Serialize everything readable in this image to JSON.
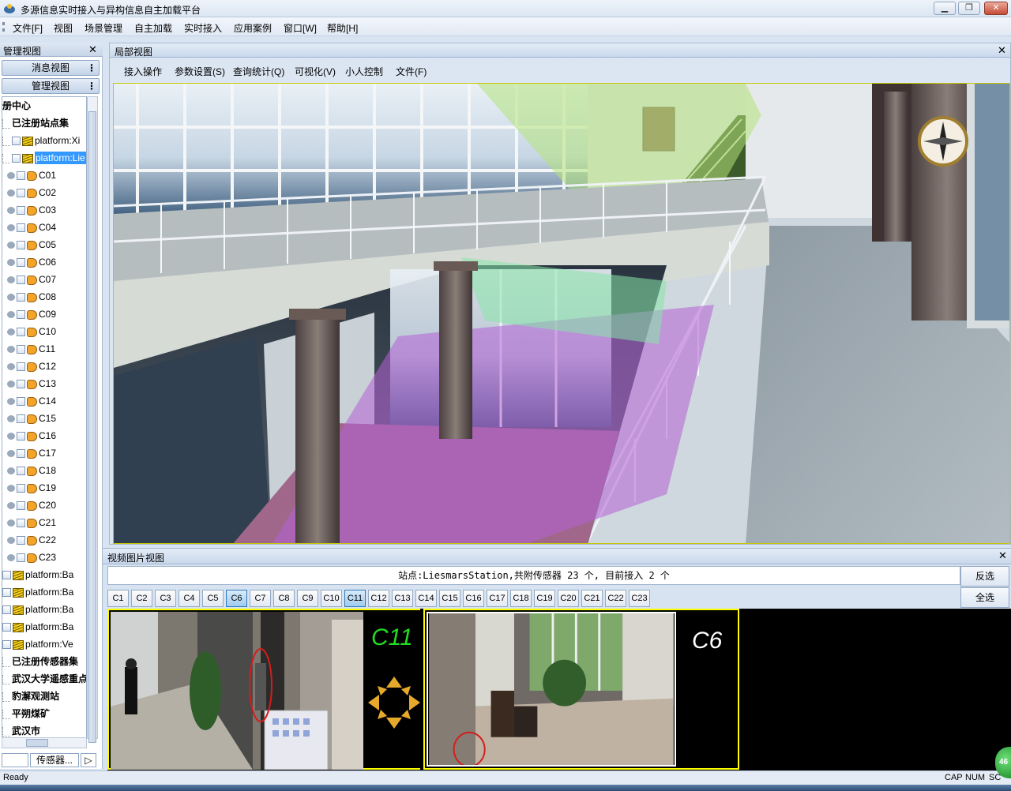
{
  "window": {
    "title": "多源信息实时接入与异构信息自主加载平台"
  },
  "menubar": [
    "文件[F]",
    "视图",
    "场景管理",
    "自主加载",
    "实时接入",
    "应用案例",
    "窗口[W]",
    "帮助[H]"
  ],
  "left_panel": {
    "title": "管理视图",
    "tabs": [
      "消息视图",
      "管理视图"
    ],
    "tree": {
      "root": "册中心",
      "registered_sites": "已注册站点集",
      "platform_1": "platform:Xi",
      "platform_selected": "platform:Lie",
      "cameras": [
        "C01",
        "C02",
        "C03",
        "C04",
        "C05",
        "C06",
        "C07",
        "C08",
        "C09",
        "C10",
        "C11",
        "C12",
        "C13",
        "C14",
        "C15",
        "C16",
        "C17",
        "C18",
        "C19",
        "C20",
        "C21",
        "C22",
        "C23"
      ],
      "platforms_more": [
        "platform:Ba",
        "platform:Ba",
        "platform:Ba",
        "platform:Ba",
        "platform:Ve"
      ],
      "groups": [
        "已注册传感器集",
        "武汉大学遥感重点",
        "豹澥观测站",
        "平朔煤矿",
        "武汉市"
      ]
    },
    "bottom_tab": "传感器..."
  },
  "local_view": {
    "title": "局部视图",
    "menu": [
      "接入操作",
      "参数设置(S)",
      "查询统计(Q)",
      "可视化(V)",
      "小人控制",
      "文件(F)"
    ]
  },
  "video_view": {
    "title": "视频图片视图",
    "station_info": "站点:LiesmarsStation,共附传感器 23 个, 目前接入 2 个",
    "buttons": {
      "invert": "反选",
      "select_all": "全选"
    },
    "channels": [
      "C1",
      "C2",
      "C3",
      "C4",
      "C5",
      "C6",
      "C7",
      "C8",
      "C9",
      "C10",
      "C11",
      "C12",
      "C13",
      "C14",
      "C15",
      "C16",
      "C17",
      "C18",
      "C19",
      "C20",
      "C21",
      "C22",
      "C23"
    ],
    "active_channels": [
      "C6",
      "C11"
    ],
    "feeds": [
      {
        "label": "C11",
        "label_color": "#22dd22"
      },
      {
        "label": "C6",
        "label_color": "#ffffff"
      }
    ]
  },
  "status": {
    "text": "Ready",
    "indicators": [
      "CAP",
      "NUM",
      "SC"
    ],
    "badge": "46"
  },
  "colors": {
    "accent": "#3399ff",
    "frame": "#ffff00"
  }
}
